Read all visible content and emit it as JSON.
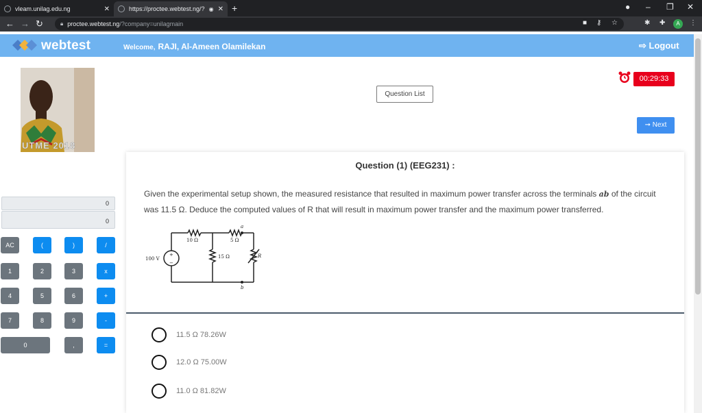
{
  "browser": {
    "tabs": [
      {
        "title": "vleam.unilag.edu.ng",
        "active": false
      },
      {
        "title": "https://proctee.webtest.ng/?",
        "active": true
      }
    ],
    "url_host": "proctee.webtest.ng",
    "url_path": "/?company=unilagmain",
    "profile_initial": "A"
  },
  "header": {
    "brand": "webtest",
    "welcome_label": "Welcome,",
    "user_name": "RAJI, Al-Ameen Olamilekan",
    "logout_label": "Logout"
  },
  "profile_photo": {
    "watermark": "UTME 2018"
  },
  "calculator": {
    "display_top": "0",
    "display_bottom": "0",
    "keys": [
      "AC",
      "(",
      ")",
      "/",
      "1",
      "2",
      "3",
      "x",
      "4",
      "5",
      "6",
      "+",
      "7",
      "8",
      "9",
      "-",
      "0",
      ",",
      "="
    ]
  },
  "timer": "00:29:33",
  "question_list_label": "Question List",
  "next_label": "Next",
  "question": {
    "title": "Question (1) (EEG231) :",
    "text_part1": "Given the experimental setup shown, the measured resistance that resulted in maximum power transfer across the terminals",
    "text_ab": "ab",
    "text_part2": "of the circuit was 11.5",
    "text_ohm": "Ω.",
    "text_part3": "Deduce the computed values of R that will result in maximum power transfer and the maximum power transferred.",
    "circuit": {
      "source": "100 V",
      "r1": "10 Ω",
      "r2": "5 Ω",
      "r3": "15 Ω",
      "rvar": "R",
      "node_a": "a",
      "node_b": "b"
    },
    "options": [
      {
        "label": "11.5  Ω  78.26W"
      },
      {
        "label": "12.0  Ω  75.00W"
      },
      {
        "label": "11.0  Ω  81.82W"
      }
    ]
  },
  "colors": {
    "header_bg": "#6fb3f0",
    "timer_bg": "#e8001c",
    "key_grey": "#6c757d",
    "key_blue": "#0d8cf0",
    "next_bg": "#3f8ff0"
  }
}
